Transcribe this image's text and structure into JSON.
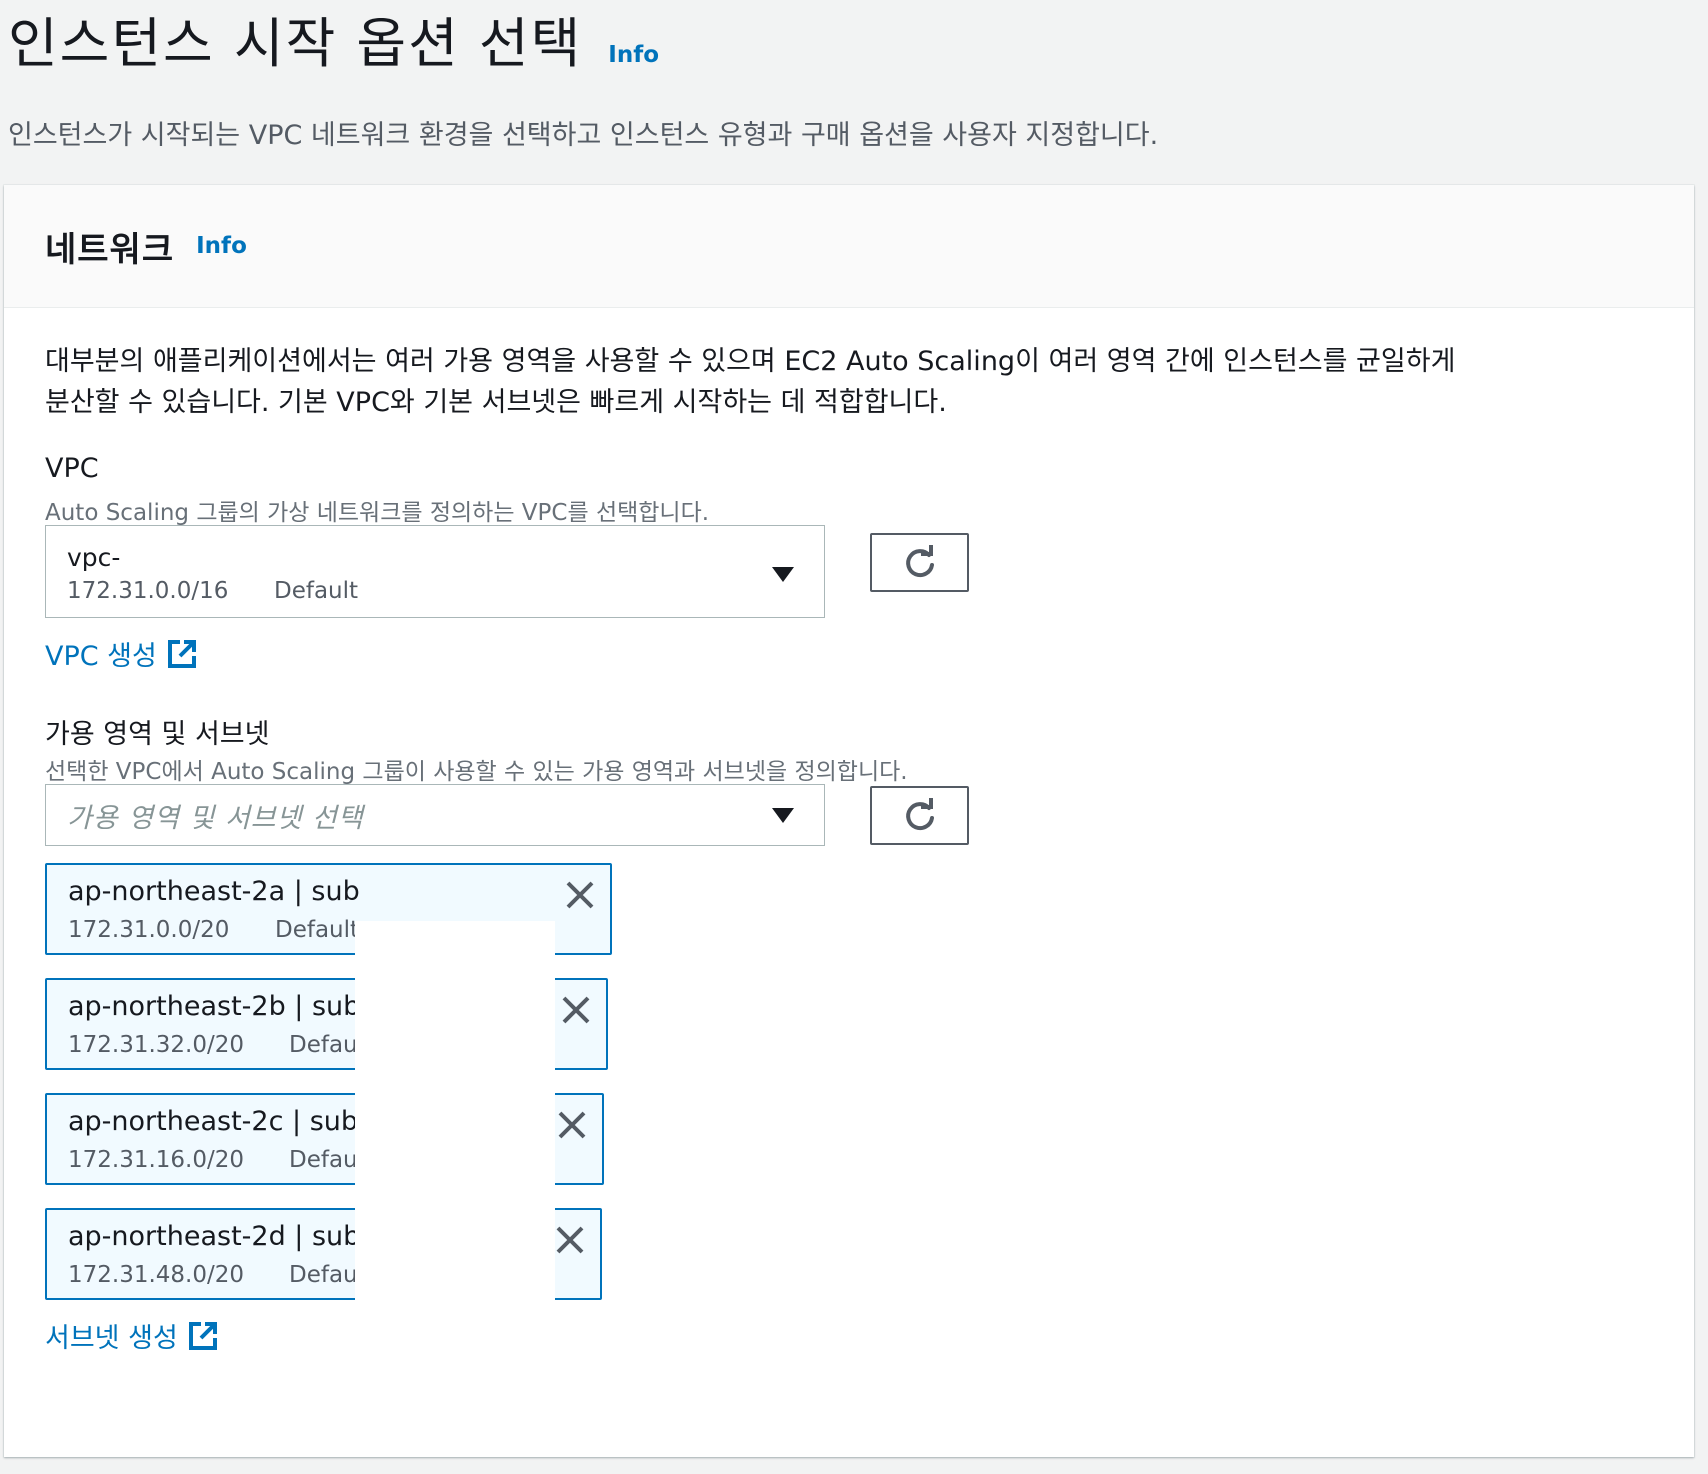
{
  "page": {
    "title": "인스턴스 시작 옵션 선택",
    "info": "Info",
    "description": "인스턴스가 시작되는 VPC 네트워크 환경을 선택하고 인스턴스 유형과 구매 옵션을 사용자 지정합니다."
  },
  "network": {
    "title": "네트워크",
    "info": "Info",
    "intro_line1": "대부분의 애플리케이션에서는 여러 가용 영역을 사용할 수 있으며 EC2 Auto Scaling이 여러 영역 간에 인스턴스를 균일하게",
    "intro_line2": "분산할 수 있습니다. 기본 VPC와 기본 서브넷은 빠르게 시작하는 데 적합합니다."
  },
  "vpc": {
    "label": "VPC",
    "description": "Auto Scaling 그룹의 가상 네트워크를 정의하는 VPC를 선택합니다.",
    "selected_id": "vpc-",
    "selected_cidr": "172.31.0.0/16",
    "selected_tag": "Default",
    "create_link": "VPC 생성"
  },
  "subnets": {
    "label": "가용 영역 및 서브넷",
    "description": "선택한 VPC에서 Auto Scaling 그룹이 사용할 수 있는 가용 영역과 서브넷을 정의합니다.",
    "placeholder": "가용 영역 및 서브넷 선택",
    "selected": [
      {
        "title": "ap-northeast-2a | sub",
        "cidr": "172.31.0.0/20",
        "tag": "Default"
      },
      {
        "title": "ap-northeast-2b | sub",
        "cidr": "172.31.32.0/20",
        "tag": "Default"
      },
      {
        "title": "ap-northeast-2c | sub",
        "cidr": "172.31.16.0/20",
        "tag": "Default"
      },
      {
        "title": "ap-northeast-2d | sub",
        "cidr": "172.31.48.0/20",
        "tag": "Default"
      }
    ],
    "create_link": "서브넷 생성"
  },
  "icons": {
    "refresh": "refresh-icon",
    "caret": "caret-down-icon",
    "external": "external-link-icon",
    "close": "close-icon"
  },
  "colors": {
    "link": "#0073bb",
    "token_border": "#0073bb",
    "token_bg": "#f1faff",
    "page_bg": "#f2f3f3"
  }
}
